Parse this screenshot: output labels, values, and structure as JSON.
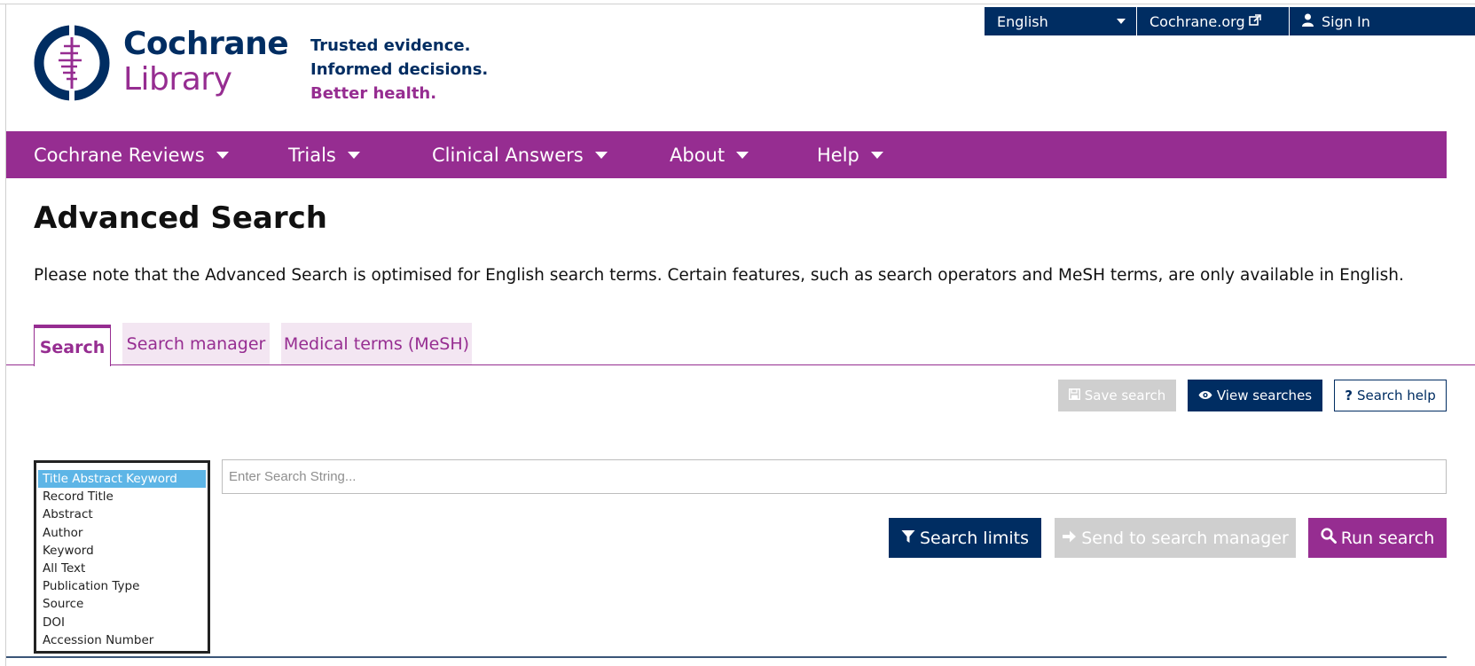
{
  "brand": {
    "name_line1": "Cochrane",
    "name_line2": "Library",
    "tagline": [
      "Trusted evidence.",
      "Informed decisions.",
      "Better health."
    ]
  },
  "utility_bar": {
    "language": "English",
    "org_link": "Cochrane.org",
    "sign_in": "Sign In"
  },
  "main_nav": {
    "items": [
      {
        "label": "Cochrane Reviews"
      },
      {
        "label": "Trials"
      },
      {
        "label": "Clinical Answers"
      },
      {
        "label": "About"
      },
      {
        "label": "Help"
      }
    ]
  },
  "page": {
    "title": "Advanced Search",
    "note": "Please note that the Advanced Search is optimised for English search terms. Certain features, such as search operators and MeSH terms, are only available in English."
  },
  "tabs": [
    {
      "label": "Search",
      "active": true
    },
    {
      "label": "Search manager",
      "active": false
    },
    {
      "label": "Medical terms (MeSH)",
      "active": false
    }
  ],
  "actions": {
    "save_search": "Save search",
    "view_searches": "View searches",
    "search_help": "Search help"
  },
  "search": {
    "field_options": [
      "Title Abstract Keyword",
      "Record Title",
      "Abstract",
      "Author",
      "Keyword",
      "All Text",
      "Publication Type",
      "Source",
      "DOI",
      "Accession Number"
    ],
    "selected_field": "Title Abstract Keyword",
    "input_placeholder": "Enter Search String...",
    "input_value": "",
    "search_limits": "Search limits",
    "send_to_manager": "Send to search manager",
    "run_search": "Run search"
  },
  "colors": {
    "navy": "#002d62",
    "purple": "#962d91",
    "tab_inactive_bg": "#f3e6f2",
    "disabled_gray": "#cfcfcf",
    "selected_option_blue": "#5db5e6"
  }
}
